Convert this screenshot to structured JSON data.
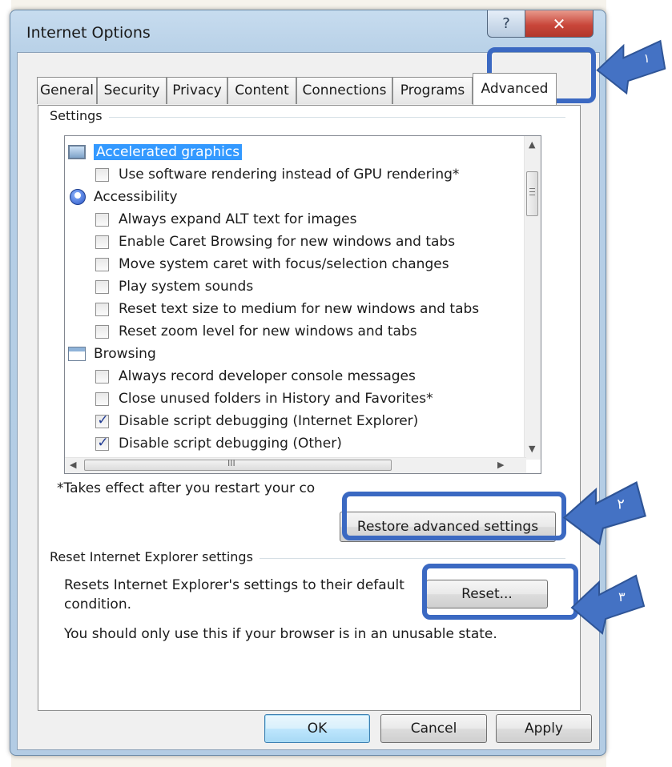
{
  "window": {
    "title": "Internet Options",
    "help_glyph": "?",
    "close_glyph": "✕"
  },
  "tabs": [
    {
      "label": "General"
    },
    {
      "label": "Security"
    },
    {
      "label": "Privacy"
    },
    {
      "label": "Content"
    },
    {
      "label": "Connections"
    },
    {
      "label": "Programs"
    },
    {
      "label": "Advanced",
      "active": true
    }
  ],
  "settings": {
    "group_label": "Settings",
    "items": [
      {
        "type": "category",
        "icon": "display-icon",
        "label": "Accelerated graphics",
        "selected": true
      },
      {
        "type": "option",
        "label": "Use software rendering instead of GPU rendering*",
        "checked": false
      },
      {
        "type": "category",
        "icon": "accessibility-icon",
        "label": "Accessibility"
      },
      {
        "type": "option",
        "label": "Always expand ALT text for images",
        "checked": false
      },
      {
        "type": "option",
        "label": "Enable Caret Browsing for new windows and tabs",
        "checked": false
      },
      {
        "type": "option",
        "label": "Move system caret with focus/selection changes",
        "checked": false
      },
      {
        "type": "option",
        "label": "Play system sounds",
        "checked": false
      },
      {
        "type": "option",
        "label": "Reset text size to medium for new windows and tabs",
        "checked": false
      },
      {
        "type": "option",
        "label": "Reset zoom level for new windows and tabs",
        "checked": false
      },
      {
        "type": "category",
        "icon": "browser-window-icon",
        "label": "Browsing"
      },
      {
        "type": "option",
        "label": "Always record developer console messages",
        "checked": false
      },
      {
        "type": "option",
        "label": "Close unused folders in History and Favorites*",
        "checked": false
      },
      {
        "type": "option",
        "label": "Disable script debugging (Internet Explorer)",
        "checked": true
      },
      {
        "type": "option",
        "label": "Disable script debugging (Other)",
        "checked": true
      }
    ],
    "hscroll_thumb_glyph": "III",
    "restart_note": "*Takes effect after you restart your co",
    "restore_button": "Restore advanced settings"
  },
  "reset_group": {
    "label": "Reset Internet Explorer settings",
    "description_line1": "Resets Internet Explorer's settings to their default",
    "description_line2": "condition.",
    "reset_button": "Reset...",
    "warning": "You should only use this if your browser is in an unusable state."
  },
  "footer": {
    "ok": "OK",
    "cancel": "Cancel",
    "apply": "Apply"
  },
  "annotations": {
    "color": "#3b69c2",
    "step1": "١",
    "step2": "٢",
    "step3": "٣"
  }
}
